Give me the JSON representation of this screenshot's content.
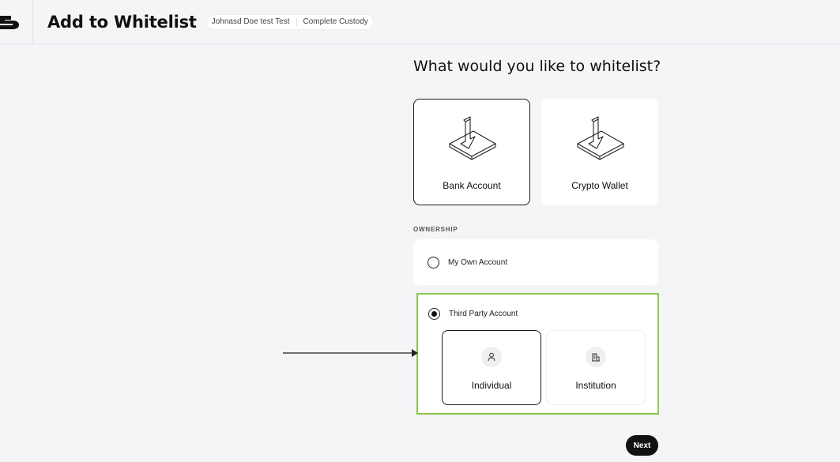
{
  "header": {
    "title": "Add to Whitelist",
    "breadcrumbs": [
      "Johnasd Doe test Test",
      "Complete Custody"
    ]
  },
  "main": {
    "question": "What would you like to whitelist?",
    "types": [
      {
        "label": "Bank Account",
        "icon": "deposit-arrow-icon",
        "selected": true
      },
      {
        "label": "Crypto Wallet",
        "icon": "deposit-arrow-icon",
        "selected": false
      }
    ],
    "ownership": {
      "section_label": "OWNERSHIP",
      "options": [
        {
          "label": "My Own Account",
          "selected": false
        },
        {
          "label": "Third Party Account",
          "selected": true
        }
      ],
      "third_party_types": [
        {
          "label": "Individual",
          "icon": "person-icon",
          "selected": true
        },
        {
          "label": "Institution",
          "icon": "building-icon",
          "selected": false
        }
      ]
    },
    "next_label": "Next"
  },
  "colors": {
    "background": "#f4f5f7",
    "highlight_border": "#8cc751",
    "primary": "#111111"
  }
}
